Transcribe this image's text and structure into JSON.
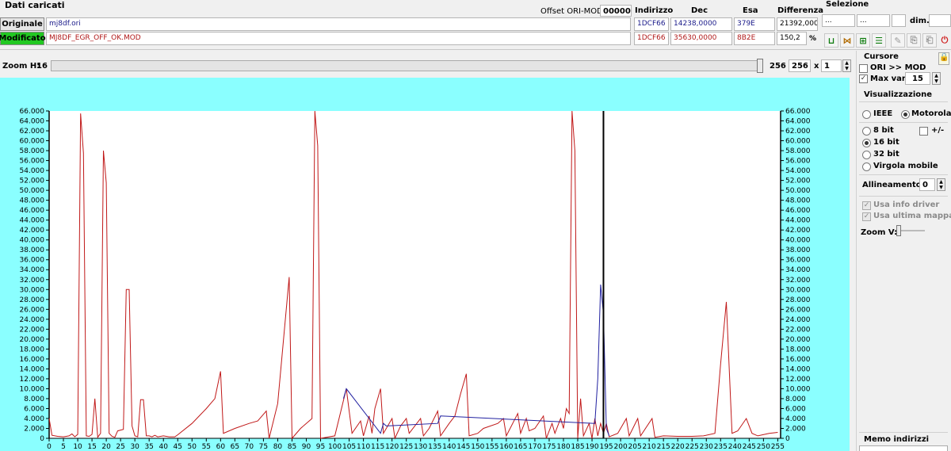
{
  "header": {
    "section_title": "Dati caricati",
    "offset_label": "Offset ORI-MOD",
    "offset_value": "000000",
    "col_indirizzo": "Indirizzo",
    "col_dec": "Dec",
    "col_esa": "Esa",
    "col_differenza": "Differenza"
  },
  "original": {
    "button_label": "Originale",
    "filename": "mj8df.ori",
    "address": "1DCF66",
    "dec": "14238,0000",
    "hex": "379E",
    "diff": "21392,000"
  },
  "modified": {
    "button_label": "Modificato",
    "filename": "MJ8DF_EGR_OFF_OK.MOD",
    "address": "1DCF66",
    "dec": "35630,0000",
    "hex": "8B2E",
    "diff_percent": "150,2",
    "percent_symbol": "%"
  },
  "selezione": {
    "title": "Selezione",
    "field1": "...",
    "field2": "...",
    "field3": "",
    "dim_label": "dim.",
    "dim_value": ""
  },
  "zoom": {
    "label": "Zoom H:",
    "value": "16",
    "slider_max": "256",
    "field_value": "256",
    "x_label": "x",
    "multiplier": "1"
  },
  "cursore": {
    "title": "Cursore",
    "ori_mod_label": "ORI >> MOD",
    "ori_mod_checked": false,
    "max_var_label": "Max var.",
    "max_var_checked": true,
    "max_var_value": "15"
  },
  "visualizzazione": {
    "title": "Visualizzazione",
    "ieee_label": "IEEE",
    "motorola_label": "Motorola",
    "bit8_label": "8 bit",
    "sign_label": "+/-",
    "bit16_label": "16 bit",
    "bit32_label": "32 bit",
    "float_label": "Virgola mobile",
    "allineamento_label": "Allineamento:",
    "allineamento_value": "0",
    "usa_info_driver": "Usa info driver",
    "usa_ultima_mappa": "Usa ultima mappa",
    "zoom_v_label": "Zoom V:"
  },
  "memo": {
    "title": "Memo indirizzi"
  },
  "colors": {
    "chart_bg": "#8affff",
    "plot_bg": "#ffffff",
    "original_line": "#2020a0",
    "modified_line": "#c01818",
    "cursor": "#000000",
    "modified_button": "#22c822"
  },
  "chart_data": {
    "type": "line",
    "x_ticks": [
      0,
      5,
      10,
      15,
      20,
      25,
      30,
      35,
      40,
      45,
      50,
      55,
      60,
      65,
      70,
      75,
      80,
      85,
      90,
      95,
      100,
      105,
      110,
      115,
      120,
      125,
      130,
      135,
      140,
      145,
      150,
      155,
      160,
      165,
      170,
      175,
      180,
      185,
      190,
      195,
      200,
      205,
      210,
      215,
      220,
      225,
      230,
      235,
      240,
      245,
      250,
      255
    ],
    "y_ticks": [
      "0",
      "2.000",
      "4.000",
      "6.000",
      "8.000",
      "10.000",
      "12.000",
      "14.000",
      "16.000",
      "18.000",
      "20.000",
      "22.000",
      "24.000",
      "26.000",
      "28.000",
      "30.000",
      "32.000",
      "34.000",
      "36.000",
      "38.000",
      "40.000",
      "42.000",
      "44.000",
      "46.000",
      "48.000",
      "50.000",
      "52.000",
      "54.000",
      "56.000",
      "58.000",
      "60.000",
      "62.000",
      "64.000",
      "66.000"
    ],
    "ylim": [
      0,
      66000
    ],
    "xlim": [
      0,
      256
    ],
    "cursor_x": 194,
    "series": [
      {
        "role": "modified",
        "points": [
          [
            0,
            4000
          ],
          [
            1,
            600
          ],
          [
            3,
            400
          ],
          [
            5,
            300
          ],
          [
            7,
            500
          ],
          [
            8,
            900
          ],
          [
            9,
            300
          ],
          [
            10,
            800
          ],
          [
            11,
            65500
          ],
          [
            12,
            57500
          ],
          [
            13,
            500
          ],
          [
            14,
            400
          ],
          [
            15,
            800
          ],
          [
            16,
            8000
          ],
          [
            17,
            200
          ],
          [
            18,
            1000
          ],
          [
            19,
            58000
          ],
          [
            20,
            51500
          ],
          [
            21,
            1000
          ],
          [
            22,
            400
          ],
          [
            23,
            200
          ],
          [
            24,
            1500
          ],
          [
            26,
            1800
          ],
          [
            27,
            30000
          ],
          [
            28,
            30000
          ],
          [
            29,
            2500
          ],
          [
            30,
            500
          ],
          [
            31,
            300
          ],
          [
            32,
            7800
          ],
          [
            33,
            7800
          ],
          [
            34,
            500
          ],
          [
            35,
            500
          ],
          [
            36,
            300
          ],
          [
            37,
            600
          ],
          [
            38,
            300
          ],
          [
            40,
            500
          ],
          [
            42,
            300
          ],
          [
            44,
            300
          ],
          [
            45,
            700
          ],
          [
            50,
            3000
          ],
          [
            55,
            6000
          ],
          [
            58,
            8000
          ],
          [
            60,
            13500
          ],
          [
            61,
            1000
          ],
          [
            65,
            2000
          ],
          [
            70,
            3000
          ],
          [
            73,
            3500
          ],
          [
            76,
            5500
          ],
          [
            77,
            0
          ],
          [
            80,
            7000
          ],
          [
            84,
            32500
          ],
          [
            85,
            0
          ],
          [
            88,
            2000
          ],
          [
            92,
            4000
          ],
          [
            93,
            66000
          ],
          [
            94,
            59000
          ],
          [
            95,
            0
          ],
          [
            100,
            500
          ],
          [
            104,
            10000
          ],
          [
            106,
            1000
          ],
          [
            109,
            3500
          ],
          [
            110,
            500
          ],
          [
            112,
            4500
          ],
          [
            113,
            1000
          ],
          [
            114,
            6000
          ],
          [
            116,
            10000
          ],
          [
            117,
            1000
          ],
          [
            120,
            4000
          ],
          [
            121,
            0
          ],
          [
            123,
            2500
          ],
          [
            125,
            4000
          ],
          [
            126,
            1000
          ],
          [
            130,
            4000
          ],
          [
            131,
            500
          ],
          [
            133,
            2000
          ],
          [
            136,
            5500
          ],
          [
            137,
            500
          ],
          [
            140,
            3000
          ],
          [
            142,
            4500
          ],
          [
            144,
            9000
          ],
          [
            146,
            13000
          ],
          [
            147,
            500
          ],
          [
            150,
            1000
          ],
          [
            152,
            2000
          ],
          [
            157,
            3000
          ],
          [
            159,
            4000
          ],
          [
            160,
            500
          ],
          [
            164,
            5000
          ],
          [
            165,
            1000
          ],
          [
            167,
            4000
          ],
          [
            168,
            1500
          ],
          [
            170,
            2000
          ],
          [
            173,
            4500
          ],
          [
            174,
            0
          ],
          [
            176,
            3000
          ],
          [
            177,
            1000
          ],
          [
            179,
            4000
          ],
          [
            180,
            2000
          ],
          [
            181,
            6000
          ],
          [
            182,
            5000
          ],
          [
            183,
            66000
          ],
          [
            184,
            58000
          ],
          [
            185,
            0
          ],
          [
            186,
            8000
          ],
          [
            187,
            500
          ],
          [
            189,
            3000
          ],
          [
            190,
            0
          ],
          [
            191,
            4000
          ],
          [
            192,
            500
          ],
          [
            193,
            3000
          ],
          [
            194,
            1000
          ],
          [
            195,
            3000
          ],
          [
            196,
            300
          ],
          [
            199,
            1000
          ],
          [
            202,
            4000
          ],
          [
            203,
            500
          ],
          [
            206,
            4000
          ],
          [
            207,
            500
          ],
          [
            211,
            4000
          ],
          [
            212,
            200
          ],
          [
            215,
            500
          ],
          [
            220,
            400
          ],
          [
            225,
            400
          ],
          [
            229,
            500
          ],
          [
            233,
            1000
          ],
          [
            235,
            15000
          ],
          [
            237,
            27500
          ],
          [
            239,
            1000
          ],
          [
            241,
            1500
          ],
          [
            244,
            4000
          ],
          [
            246,
            1000
          ],
          [
            248,
            500
          ],
          [
            252,
            1000
          ],
          [
            255,
            1200
          ]
        ]
      },
      {
        "role": "original",
        "points": [
          [
            103,
            8000
          ],
          [
            104,
            10000
          ],
          [
            116,
            1000
          ],
          [
            117,
            3000
          ],
          [
            118,
            2500
          ],
          [
            136,
            3000
          ],
          [
            137,
            4500
          ],
          [
            191,
            3000
          ],
          [
            192,
            12000
          ],
          [
            193,
            31000
          ],
          [
            194,
            25000
          ],
          [
            195,
            2000
          ],
          [
            196,
            500
          ]
        ]
      }
    ]
  }
}
